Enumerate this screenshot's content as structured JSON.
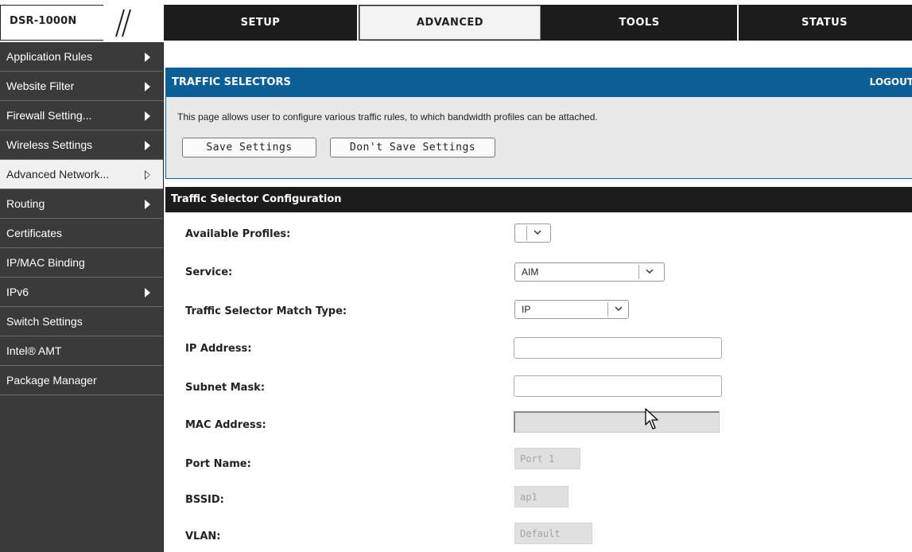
{
  "brand": {
    "model": "DSR-1000N"
  },
  "nav": {
    "tabs": [
      {
        "label": "SETUP"
      },
      {
        "label": "ADVANCED"
      },
      {
        "label": "TOOLS"
      },
      {
        "label": "STATUS"
      }
    ],
    "active_tab": "ADVANCED"
  },
  "sidebar": {
    "items": [
      {
        "label": "Application Rules"
      },
      {
        "label": "Website Filter"
      },
      {
        "label": "Firewall Setting..."
      },
      {
        "label": "Wireless Settings"
      },
      {
        "label": "Advanced Network..."
      },
      {
        "label": "Routing"
      },
      {
        "label": "Certificates"
      },
      {
        "label": "IP/MAC Binding"
      },
      {
        "label": "IPv6"
      },
      {
        "label": "Switch Settings"
      },
      {
        "label": "Intel® AMT"
      },
      {
        "label": "Package Manager"
      }
    ],
    "active_item": "Advanced Network..."
  },
  "section": {
    "title": "TRAFFIC SELECTORS",
    "logout": "LOGOUT",
    "description": "This page allows user to configure various traffic rules, to which bandwidth profiles can be attached.",
    "save_label": "Save Settings",
    "dont_save_label": "Don't Save Settings"
  },
  "config": {
    "title": "Traffic Selector Configuration",
    "available_profiles": {
      "label": "Available Profiles:",
      "value": ""
    },
    "service": {
      "label": "Service:",
      "value": "AIM"
    },
    "match_type": {
      "label": "Traffic Selector Match Type:",
      "value": "IP"
    },
    "ip_address": {
      "label": "IP Address:",
      "value": ""
    },
    "subnet_mask": {
      "label": "Subnet Mask:",
      "value": ""
    },
    "mac_address": {
      "label": "MAC Address:",
      "value": ""
    },
    "port_name": {
      "label": "Port Name:",
      "placeholder": "Port 1"
    },
    "bssid": {
      "label": "BSSID:",
      "placeholder": "ap1"
    },
    "vlan": {
      "label": "VLAN:",
      "placeholder": "Default"
    }
  },
  "icons": {
    "submenu_arrow": "triangle-right-icon",
    "dropdown": "chevron-down-icon",
    "cursor": "mouse-pointer-icon"
  },
  "colors": {
    "header_blue": "#0b5f96",
    "nav_dark": "#1c1c1c",
    "sidebar_bg": "#3a3a3a"
  }
}
